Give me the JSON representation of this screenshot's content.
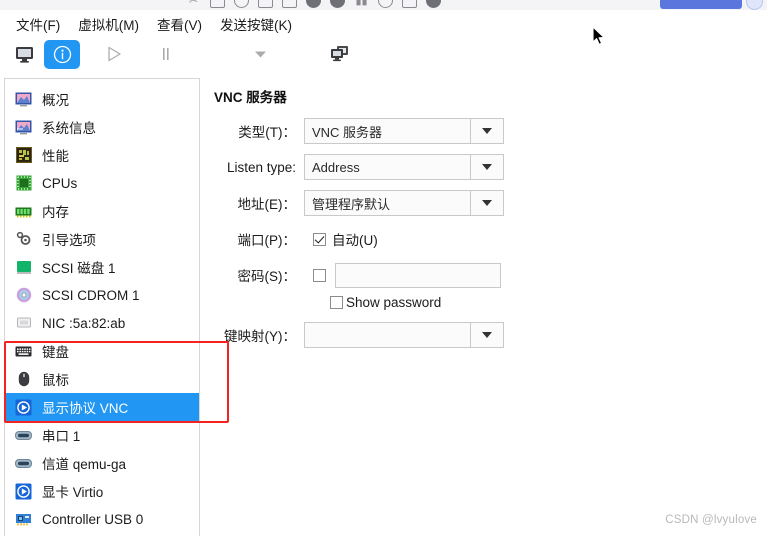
{
  "window": {
    "menus": [
      {
        "label": "文件(F)",
        "name": "menu-file"
      },
      {
        "label": "虚拟机(M)",
        "name": "menu-virtual-machine"
      },
      {
        "label": "查看(V)",
        "name": "menu-view"
      },
      {
        "label": "发送按键(K)",
        "name": "menu-send-key"
      }
    ]
  },
  "toolbar": {
    "buttons": [
      {
        "name": "toolbar-console-button",
        "icon": "monitor-icon",
        "state": "normal"
      },
      {
        "name": "toolbar-details-button",
        "icon": "info-icon",
        "state": "active"
      },
      {
        "name": "toolbar-run-button",
        "icon": "play-icon",
        "state": "disabled"
      },
      {
        "name": "toolbar-pause-button",
        "icon": "pause-icon",
        "state": "disabled"
      },
      {
        "name": "toolbar-shutdown-menu-button",
        "icon": "chevron-down-icon",
        "state": "disabled"
      },
      {
        "name": "toolbar-snapshots-button",
        "icon": "windows-stack-icon",
        "state": "normal"
      }
    ]
  },
  "sidebar": {
    "items": [
      {
        "label": "概况",
        "icon": "overview-icon",
        "selected": false
      },
      {
        "label": "系统信息",
        "icon": "system-info-icon",
        "selected": false
      },
      {
        "label": "性能",
        "icon": "performance-icon",
        "selected": false
      },
      {
        "label": "CPUs",
        "icon": "cpu-icon",
        "selected": false
      },
      {
        "label": "内存",
        "icon": "memory-icon",
        "selected": false
      },
      {
        "label": "引导选项",
        "icon": "boot-options-icon",
        "selected": false
      },
      {
        "label": "SCSI 磁盘 1",
        "icon": "disk-icon",
        "selected": false
      },
      {
        "label": "SCSI CDROM 1",
        "icon": "cdrom-icon",
        "selected": false
      },
      {
        "label": "NIC :5a:82:ab",
        "icon": "nic-icon",
        "selected": false
      },
      {
        "label": "键盘",
        "icon": "keyboard-icon",
        "selected": false
      },
      {
        "label": "鼠标",
        "icon": "mouse-icon",
        "selected": false
      },
      {
        "label": "显示协议 VNC",
        "icon": "display-icon",
        "selected": true
      },
      {
        "label": "串口 1",
        "icon": "serial-port-icon",
        "selected": false
      },
      {
        "label": "信道 qemu-ga",
        "icon": "channel-icon",
        "selected": false
      },
      {
        "label": "显卡 Virtio",
        "icon": "video-card-icon",
        "selected": false
      },
      {
        "label": "Controller USB 0",
        "icon": "usb-controller-icon",
        "selected": false
      }
    ]
  },
  "panel": {
    "title": "VNC 服务器",
    "fields": {
      "type_label": "类型(T)：",
      "type_value": "VNC 服务器",
      "listen_type_label": "Listen type:",
      "listen_type_value": "Address",
      "address_label": "地址(E)：",
      "address_value": "管理程序默认",
      "port_label": "端口(P)：",
      "port_auto_label": "自动(U)",
      "port_auto_checked": true,
      "password_label": "密码(S)：",
      "password_value": "",
      "password_enabled": false,
      "show_password_label": "Show password",
      "show_password_checked": false,
      "keymap_label": "键映射(Y)：",
      "keymap_value": ""
    }
  },
  "annotation": {
    "highlight_color": "#f5231f"
  },
  "watermark": {
    "text": "CSDN @lvyulove"
  }
}
